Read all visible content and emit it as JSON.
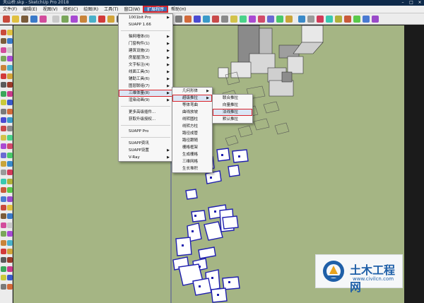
{
  "window": {
    "title": "天山桥.skp - SketchUp Pro 2018"
  },
  "menubar": {
    "items": [
      "文件(F)",
      "编辑(E)",
      "视图(V)",
      "相机(C)",
      "绘图(R)",
      "工具(T)",
      "窗口(W)",
      "扩展程序",
      "帮助(H)"
    ]
  },
  "extensions_menu": {
    "items": [
      {
        "label": "1001bit Pro",
        "arrow": true
      },
      {
        "label": "SUAPP 1.66",
        "arrow": false
      },
      {
        "sep": true
      },
      {
        "label": "轴网墙体(0)",
        "arrow": true
      },
      {
        "label": "门窗构件(1)",
        "arrow": true
      },
      {
        "label": "建筑设施(2)",
        "arrow": true
      },
      {
        "label": "房屋屋顶(3)",
        "arrow": true
      },
      {
        "label": "文字标注(4)",
        "arrow": true
      },
      {
        "label": "线面工具(5)",
        "arrow": true
      },
      {
        "label": "辅助工具(6)",
        "arrow": true
      },
      {
        "label": "图层联组(7)",
        "arrow": true
      },
      {
        "label": "三维体量(8)",
        "arrow": true,
        "highlight": true,
        "boxed": true
      },
      {
        "label": "渲染动画(9)",
        "arrow": true
      },
      {
        "sep": true
      },
      {
        "label": "更多高级插件...",
        "arrow": false
      },
      {
        "label": "获取升级授权...",
        "arrow": false
      },
      {
        "sep": true
      },
      {
        "label": "SUAPP Pro",
        "arrow": false
      },
      {
        "sep": true
      },
      {
        "label": "SUAPP资讯",
        "arrow": false
      },
      {
        "label": "SUAPP设置",
        "arrow": true
      },
      {
        "label": "V-Ray",
        "arrow": true
      }
    ]
  },
  "solid_menu": {
    "items": [
      {
        "label": "几何形体",
        "arrow": true
      },
      {
        "label": "超级推拉",
        "arrow": true,
        "highlight": true,
        "boxed": true
      },
      {
        "label": "等体弯曲",
        "arrow": false
      },
      {
        "label": "曲线放坡",
        "arrow": false
      },
      {
        "label": "线转圆柱",
        "arrow": false
      },
      {
        "label": "线转方柱",
        "arrow": false
      },
      {
        "label": "路径成管",
        "arrow": false
      },
      {
        "label": "路径跟随",
        "arrow": false
      },
      {
        "label": "栅格框架",
        "arrow": false
      },
      {
        "label": "生成栅格",
        "arrow": false
      },
      {
        "label": "三维网格",
        "arrow": false
      },
      {
        "label": "生长堆积",
        "arrow": false
      }
    ]
  },
  "pushpull_menu": {
    "items": [
      {
        "label": "联合推拉",
        "arrow": false
      },
      {
        "label": "向量推拉",
        "arrow": false
      },
      {
        "label": "法线推拉",
        "arrow": false,
        "highlight": true,
        "boxed": true
      },
      {
        "label": "默认推拉",
        "arrow": false
      }
    ]
  },
  "watermark": {
    "title": "土木工程网",
    "url": "www.civilcn.com"
  },
  "colors": {
    "viewport": "#a5b584",
    "accent": "#d9242b",
    "selection": "#1f1fb0",
    "highlight": "#dbe6f5"
  }
}
